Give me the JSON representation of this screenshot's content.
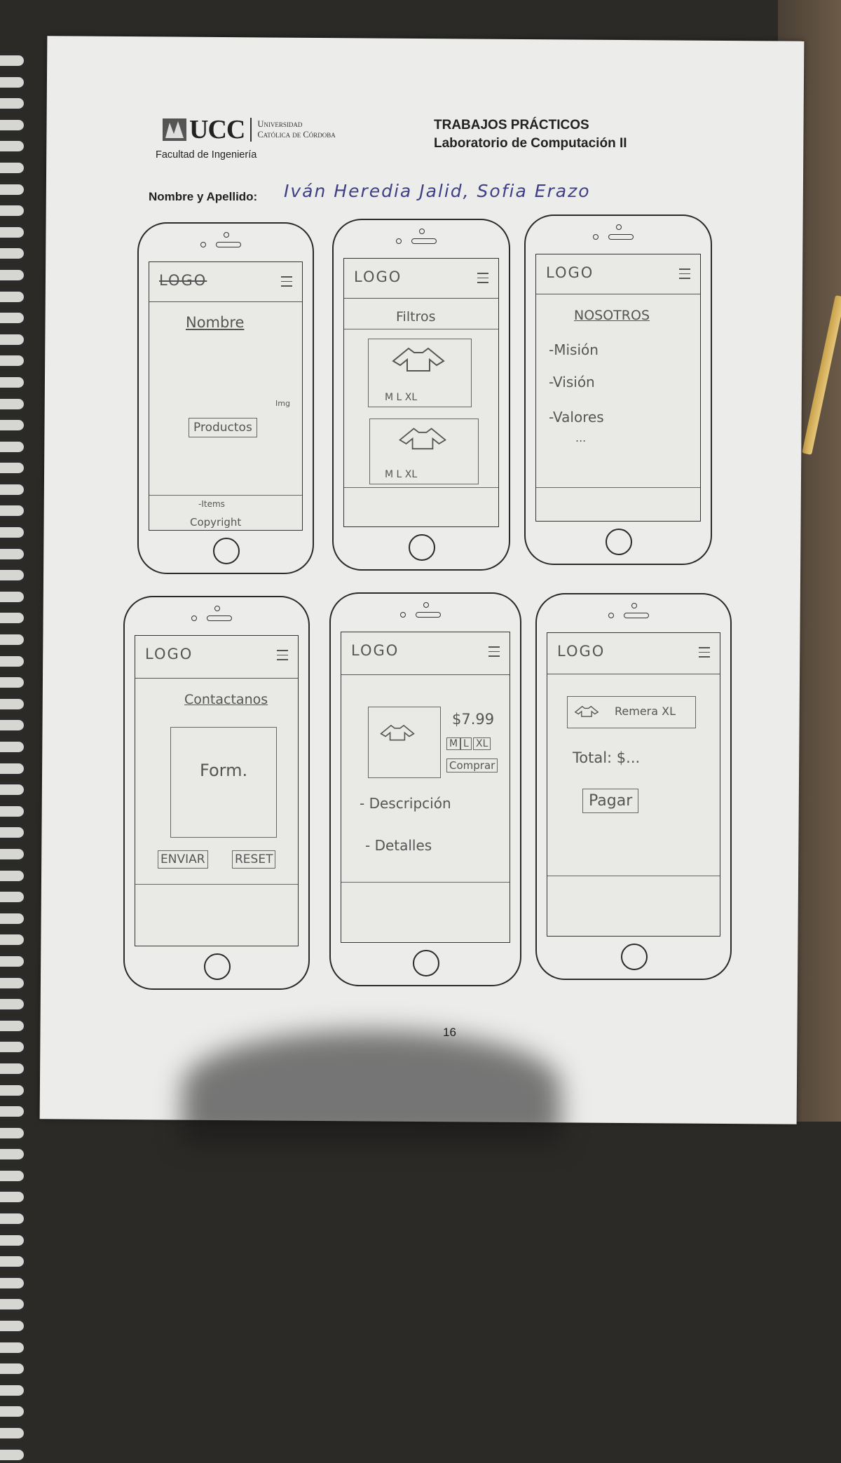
{
  "header": {
    "logo_text": "UCC",
    "logo_full_line1": "Universidad",
    "logo_full_line2": "Católica de Córdoba",
    "faculty": "Facultad de Ingeniería",
    "title": "TRABAJOS PRÁCTICOS",
    "subtitle": "Laboratorio de Computación II",
    "name_label": "Nombre y Apellido:",
    "name_value": "Iván Heredia Jalid, Sofia Erazo"
  },
  "page_number": "16",
  "wireframes": {
    "common_logo": "LOGO",
    "home": {
      "logo": "LOGO",
      "title": "Nombre",
      "img_note": "Img",
      "button": "Productos",
      "footer_items": "-Items",
      "footer_copyright": "Copyright"
    },
    "products": {
      "filters": "Filtros",
      "sizes_1": "M L XL",
      "sizes_2": "M  L  XL"
    },
    "about": {
      "title": "NOSOTROS",
      "item1": "-Misión",
      "item2": "-Visión",
      "item3": "-Valores",
      "more": "..."
    },
    "contact": {
      "title": "Contactanos",
      "form": "Form.",
      "send": "ENVIAR",
      "reset": "RESET"
    },
    "detail": {
      "price": "$7.99",
      "sizes": [
        "M",
        "L",
        "XL"
      ],
      "buy": "Comprar",
      "description": "- Descripción",
      "details": "- Detalles"
    },
    "cart": {
      "item": "Remera XL",
      "total": "Total: $...",
      "pay": "Pagar"
    }
  }
}
